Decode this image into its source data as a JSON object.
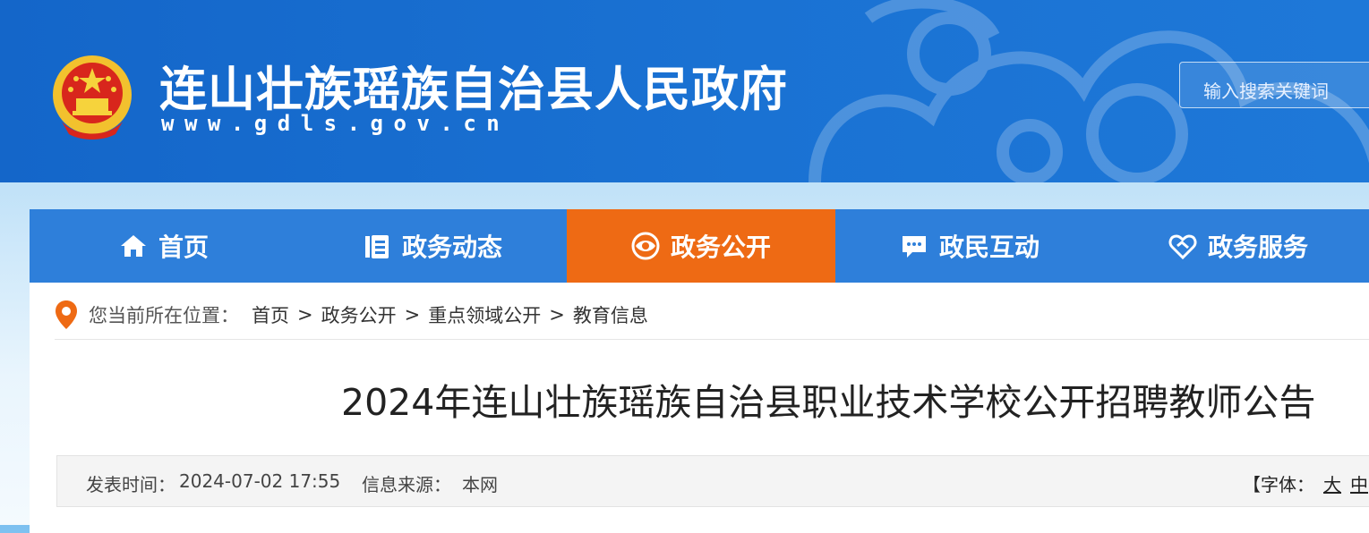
{
  "header": {
    "site_title": "连山壮族瑶族自治县人民政府",
    "site_url": "www.gdls.gov.cn",
    "search_placeholder": "输入搜索关键词"
  },
  "nav": {
    "items": [
      {
        "label": "首页",
        "icon": "home-icon"
      },
      {
        "label": "政务动态",
        "icon": "news-list-icon"
      },
      {
        "label": "政务公开",
        "icon": "eye-icon",
        "active": true
      },
      {
        "label": "政民互动",
        "icon": "chat-icon"
      },
      {
        "label": "政务服务",
        "icon": "handshake-icon"
      }
    ],
    "active_color": "#ee6a14",
    "bar_color": "#2e7fda"
  },
  "breadcrumb": {
    "prefix": "您当前所在位置：",
    "items": [
      "首页",
      "政务公开",
      "重点领域公开",
      "教育信息"
    ],
    "separator": ">"
  },
  "article": {
    "title": "2024年连山壮族瑶族自治县职业技术学校公开招聘教师公告",
    "publish_label": "发表时间：",
    "publish_time": "2024-07-02 17:55",
    "source_label": "信息来源：",
    "source": "本网",
    "font_size_label": "【字体：",
    "font_size_options": [
      "大",
      "中"
    ]
  }
}
